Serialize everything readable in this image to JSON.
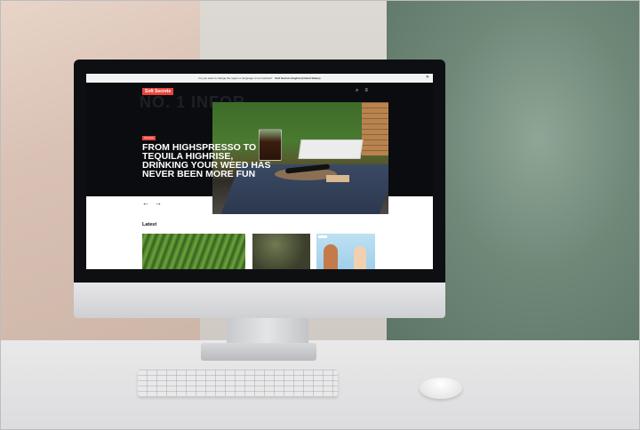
{
  "notice": {
    "text": "Do you want to change the region or language of our website?",
    "option": "Soft Secrets English (United States)",
    "close_icon": "close-icon"
  },
  "site": {
    "logo": "Soft Secrets",
    "ghost_text": "NO. 1 INFOR",
    "category_badge": "Lifestyle",
    "headline": "FROM HIGHSPRESSO TO TEQUILA HIGHRISE, DRINKING YOUR WEED HAS NEVER BEEN MORE FUN",
    "prev_arrow": "←",
    "next_arrow": "→",
    "latest_heading": "Latest",
    "search_icon": "⌕",
    "menu_icon": "≡"
  },
  "colors": {
    "accent": "#e8453c",
    "hero_bg": "#0b0c10"
  }
}
